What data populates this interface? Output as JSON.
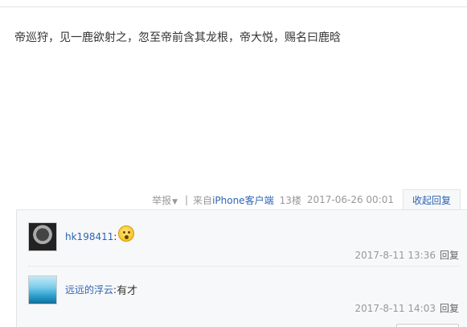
{
  "post": {
    "content": "帝巡狩，见一鹿欲射之，忽至帝前含其龙根，帝大悦，赐名曰鹿晗"
  },
  "meta": {
    "report": "举报",
    "source_prefix": "来自",
    "source_link": "iPhone客户端",
    "floor": "13楼",
    "timestamp": "2017-06-26 00:01",
    "toggle_replies": "收起回复"
  },
  "replies": [
    {
      "user": "hk198411",
      "colon": ":",
      "text": "",
      "emoji": "surprised-emoji",
      "time": "2017-8-11 13:36",
      "reply_label": "回复"
    },
    {
      "user": "远远的浮云",
      "colon": ":",
      "text": "有才",
      "time": "2017-8-11 14:03",
      "reply_label": "回复"
    }
  ]
}
